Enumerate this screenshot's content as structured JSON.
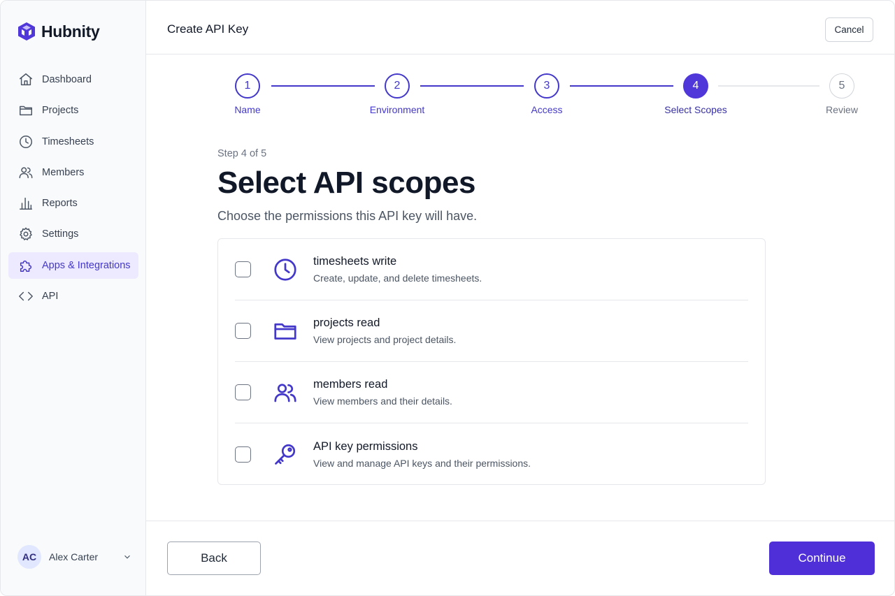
{
  "app": {
    "brand_name": "Hubnity",
    "brand_color": "#4f37d9"
  },
  "sidebar": {
    "items": [
      {
        "label": "Dashboard",
        "icon": "home-icon"
      },
      {
        "label": "Projects",
        "icon": "folder-icon"
      },
      {
        "label": "Timesheets",
        "icon": "clock-icon"
      },
      {
        "label": "Members",
        "icon": "users-icon"
      },
      {
        "label": "Reports",
        "icon": "bar-chart-icon"
      },
      {
        "label": "Settings",
        "icon": "gear-icon"
      },
      {
        "label": "Apps & Integrations",
        "icon": "puzzle-icon",
        "active": true
      },
      {
        "label": "API",
        "icon": "code-icon"
      }
    ],
    "user": {
      "initials": "AC",
      "name": "Alex Carter"
    }
  },
  "header": {
    "title": "Create API Key",
    "cancel_label": "Cancel"
  },
  "stepper": {
    "steps": [
      {
        "number": "1",
        "label": "Name",
        "state": "complete"
      },
      {
        "number": "2",
        "label": "Environment",
        "state": "complete"
      },
      {
        "number": "3",
        "label": "Access",
        "state": "complete"
      },
      {
        "number": "4",
        "label": "Select Scopes",
        "state": "current"
      },
      {
        "number": "5",
        "label": "Review",
        "state": "upcoming"
      }
    ]
  },
  "content": {
    "step_count": "Step 4 of 5",
    "heading": "Select API scopes",
    "subheading": "Choose the permissions this API key will have.",
    "scopes": [
      {
        "title": "timesheets write",
        "description": "Create, update, and delete timesheets.",
        "icon": "clock-icon",
        "checked": false
      },
      {
        "title": "projects read",
        "description": "View projects and project details.",
        "icon": "folder-icon",
        "checked": false
      },
      {
        "title": "members read",
        "description": "View members and their details.",
        "icon": "users-icon",
        "checked": false
      },
      {
        "title": "API key permissions",
        "description": "View and manage API keys and their permissions.",
        "icon": "key-icon",
        "checked": false
      }
    ]
  },
  "footer": {
    "back_label": "Back",
    "continue_label": "Continue"
  }
}
